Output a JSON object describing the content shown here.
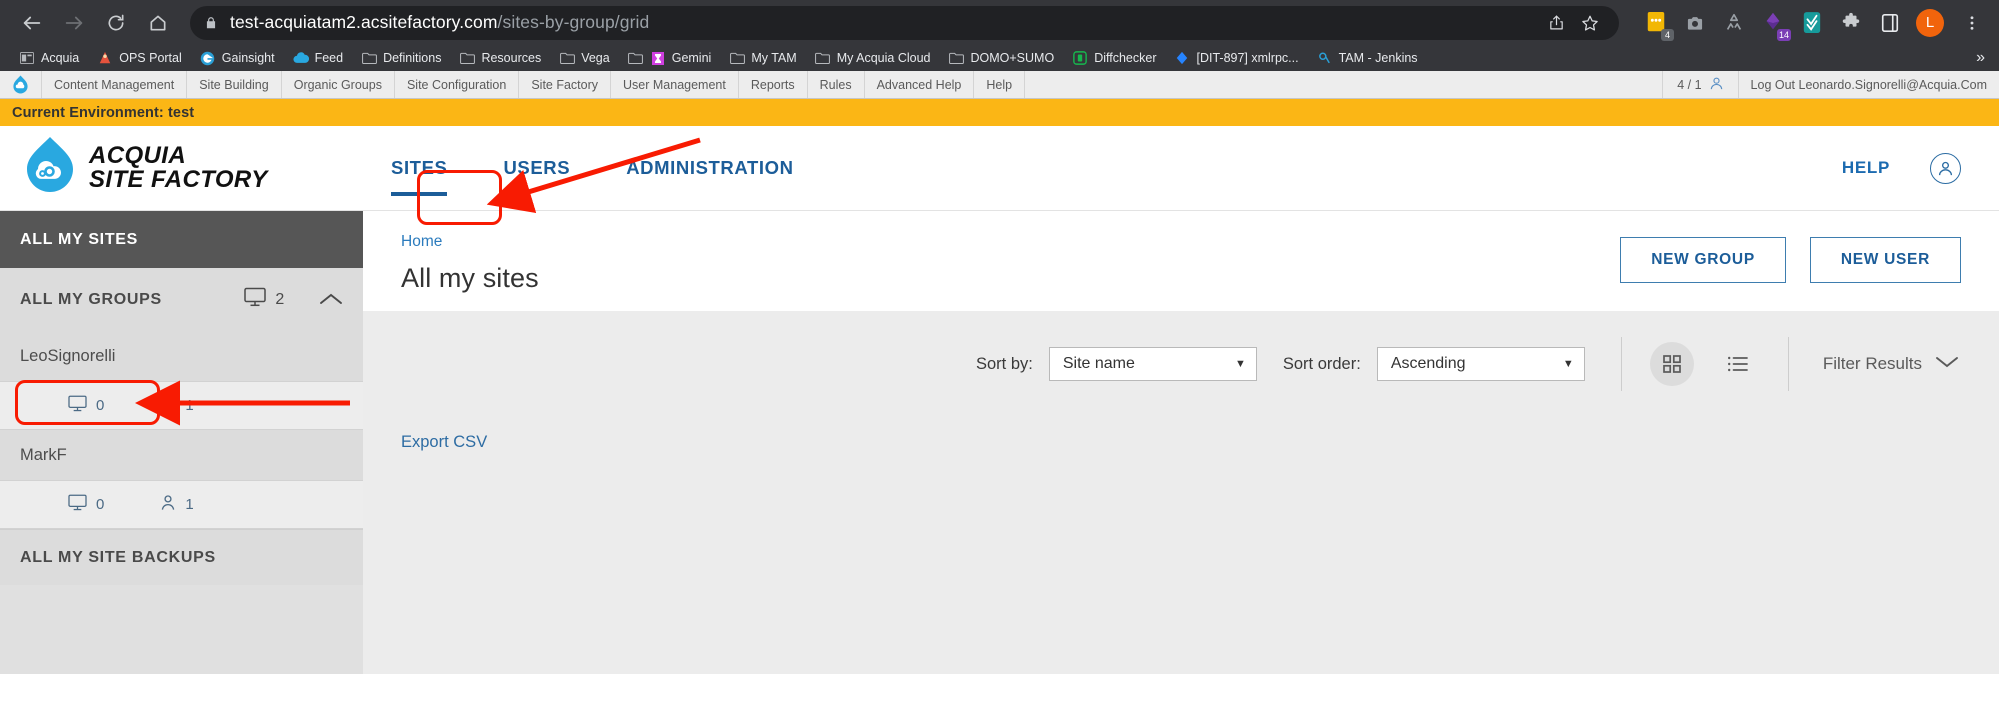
{
  "browser": {
    "url_domain": "test-acquiatam2.acsitefactory.com",
    "url_path": "/sites-by-group/grid",
    "nav": {
      "back": "back-arrow",
      "forward": "forward-arrow",
      "reload": "reload",
      "home": "home"
    },
    "omni_actions": [
      "share-icon",
      "bookmark-star-icon"
    ],
    "extensions": [
      {
        "name": "sticky-notes-extension",
        "badge": "4",
        "badge_color": "#5f6368",
        "color": "#f2b705"
      },
      {
        "name": "camera-extension",
        "badge": "",
        "badge_color": "",
        "color": "#9aa0a6"
      },
      {
        "name": "recycle-extension",
        "badge": "",
        "badge_color": "",
        "color": "#9aa0a6"
      },
      {
        "name": "diamond-extension",
        "badge": "14",
        "badge_color": "#7b3fb5",
        "color": "#5b2d91"
      },
      {
        "name": "checkmark-extension",
        "badge": "",
        "badge_color": "",
        "color": "#169b9b"
      },
      {
        "name": "puzzle-extension",
        "badge": "",
        "badge_color": "",
        "color": "#c9cccf"
      },
      {
        "name": "sidepanel-extension",
        "badge": "",
        "badge_color": "",
        "color": "#e8eaed"
      }
    ],
    "profile_initial": "L",
    "menu": "kebab-menu-icon"
  },
  "bookmarks": [
    {
      "label": "Acquia",
      "icon": "window-icon",
      "color": "#b6b9bd"
    },
    {
      "label": "OPS Portal",
      "icon": "portal-icon",
      "color": "#e5533d"
    },
    {
      "label": "Gainsight",
      "icon": "gainsight-icon",
      "color": "#2a9fd6"
    },
    {
      "label": "Feed",
      "icon": "feed-cloud-icon",
      "color": "#29a8e0"
    },
    {
      "label": "Definitions",
      "icon": "folder-icon",
      "color": "#b6b9bd"
    },
    {
      "label": "Resources",
      "icon": "folder-icon",
      "color": "#b6b9bd"
    },
    {
      "label": "Vega",
      "icon": "folder-icon",
      "color": "#b6b9bd"
    },
    {
      "label": "Gemini",
      "icon": "folder-gemini-icon",
      "color": "#cf3fe0"
    },
    {
      "label": "My TAM",
      "icon": "folder-icon",
      "color": "#b6b9bd"
    },
    {
      "label": "My Acquia Cloud",
      "icon": "folder-icon",
      "color": "#b6b9bd"
    },
    {
      "label": "DOMO+SUMO",
      "icon": "folder-icon",
      "color": "#b6b9bd"
    },
    {
      "label": "Diffchecker",
      "icon": "diffchecker-icon",
      "color": "#16b84e"
    },
    {
      "label": "[DIT-897] xmlrpc...",
      "icon": "jira-icon",
      "color": "#2684ff"
    },
    {
      "label": "TAM - Jenkins",
      "icon": "jenkins-icon",
      "color": "#2a9fd6"
    }
  ],
  "bookmarks_overflow": "»",
  "admin_bar": {
    "logo": "drupal-droplet-icon",
    "items": [
      "Content Management",
      "Site Building",
      "Organic Groups",
      "Site Configuration",
      "Site Factory",
      "User Management",
      "Reports",
      "Rules",
      "Advanced Help",
      "Help"
    ],
    "counter": "4 / 1",
    "counter_icon": "user-icon",
    "logout": "Log Out Leonardo.Signorelli@Acquia.Com"
  },
  "env_banner": {
    "text": "Current Environment: test",
    "color": "#fbb615"
  },
  "app_header": {
    "logo": {
      "line1": "ACQUIA",
      "line2": "SITE FACTORY",
      "icon": "acquia-droplet-logo"
    },
    "tabs": [
      {
        "label": "SITES",
        "active": true
      },
      {
        "label": "USERS",
        "active": false
      },
      {
        "label": "ADMINISTRATION",
        "active": false
      }
    ],
    "help": "HELP",
    "account_icon": "account-circle-icon"
  },
  "sidebar": {
    "all_sites": "ALL MY SITES",
    "groups_header": "ALL MY GROUPS",
    "groups_count": "2",
    "groups_count_icon": "monitor-icon",
    "collapse_icon": "chevron-up-icon",
    "groups": [
      {
        "name": "LeoSignorelli",
        "sites": "0",
        "users": "1",
        "highlighted": true
      },
      {
        "name": "MarkF",
        "sites": "0",
        "users": "1",
        "highlighted": false
      }
    ],
    "backups": "ALL MY SITE BACKUPS"
  },
  "main": {
    "breadcrumb": "Home",
    "title": "All my sites",
    "buttons": [
      {
        "label": "NEW GROUP",
        "name": "new-group-button"
      },
      {
        "label": "NEW USER",
        "name": "new-user-button"
      }
    ],
    "sort_by_label": "Sort by:",
    "sort_by_value": "Site name",
    "sort_order_label": "Sort order:",
    "sort_order_value": "Ascending",
    "grid_view_icon": "grid-view-icon",
    "list_view_icon": "list-view-icon",
    "filter_results": "Filter Results",
    "filter_chevron": "chevron-down-icon",
    "export_csv": "Export CSV"
  },
  "annotations": {
    "highlight_color": "#f81b02",
    "boxes": [
      "sites-tab-highlight",
      "leosignorelli-highlight"
    ],
    "arrows": [
      "arrow-to-sites-tab",
      "arrow-to-leosignorelli"
    ]
  }
}
